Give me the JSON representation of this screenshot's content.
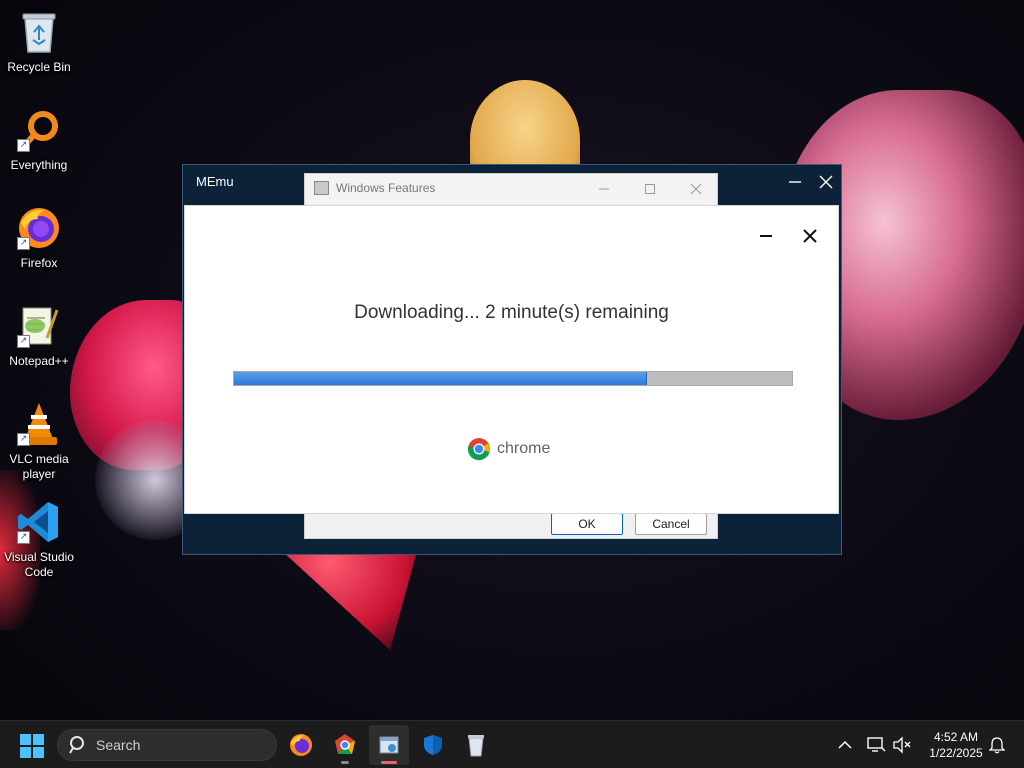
{
  "desktop": {
    "icons": [
      {
        "label": "Recycle Bin",
        "icon": "recycle-bin-icon"
      },
      {
        "label": "Everything",
        "icon": "everything-search-icon"
      },
      {
        "label": "Firefox",
        "icon": "firefox-icon"
      },
      {
        "label": "Notepad++",
        "icon": "notepad-plus-plus-icon"
      },
      {
        "label": "VLC media player",
        "icon": "vlc-icon"
      },
      {
        "label": "Visual Studio Code",
        "icon": "vscode-icon"
      }
    ]
  },
  "memu_window": {
    "title": "MEmu",
    "minimize": "—",
    "close": "✕"
  },
  "windows_features": {
    "title": "Windows Features",
    "ok_label": "OK",
    "cancel_label": "Cancel"
  },
  "chrome_installer": {
    "status_text": "Downloading... 2 minute(s) remaining",
    "progress_fraction": 0.74,
    "brand": "chrome",
    "colors": {
      "progress": "#3a86e0",
      "track": "#bcbcbc"
    }
  },
  "taskbar": {
    "search_placeholder": "Search",
    "apps": [
      "firefox-icon",
      "chrome-icon",
      "windows-features-icon",
      "defender-icon",
      "recycle-bin-icon"
    ],
    "clock": {
      "time": "4:52 AM",
      "date": "1/22/2025"
    }
  }
}
